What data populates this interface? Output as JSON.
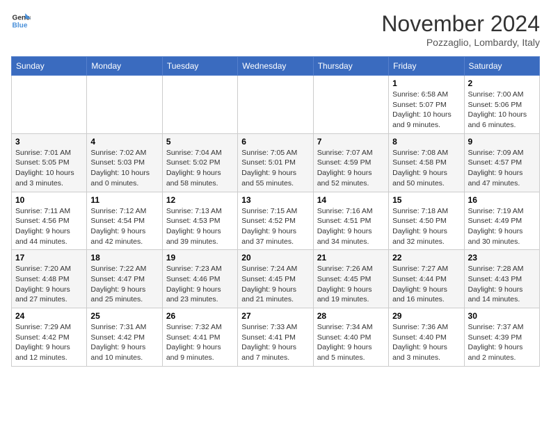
{
  "header": {
    "logo_line1": "General",
    "logo_line2": "Blue",
    "month_title": "November 2024",
    "location": "Pozzaglio, Lombardy, Italy"
  },
  "weekdays": [
    "Sunday",
    "Monday",
    "Tuesday",
    "Wednesday",
    "Thursday",
    "Friday",
    "Saturday"
  ],
  "rows": [
    {
      "cells": [
        {
          "day": "",
          "info": ""
        },
        {
          "day": "",
          "info": ""
        },
        {
          "day": "",
          "info": ""
        },
        {
          "day": "",
          "info": ""
        },
        {
          "day": "",
          "info": ""
        },
        {
          "day": "1",
          "info": "Sunrise: 6:58 AM\nSunset: 5:07 PM\nDaylight: 10 hours\nand 9 minutes."
        },
        {
          "day": "2",
          "info": "Sunrise: 7:00 AM\nSunset: 5:06 PM\nDaylight: 10 hours\nand 6 minutes."
        }
      ]
    },
    {
      "cells": [
        {
          "day": "3",
          "info": "Sunrise: 7:01 AM\nSunset: 5:05 PM\nDaylight: 10 hours\nand 3 minutes."
        },
        {
          "day": "4",
          "info": "Sunrise: 7:02 AM\nSunset: 5:03 PM\nDaylight: 10 hours\nand 0 minutes."
        },
        {
          "day": "5",
          "info": "Sunrise: 7:04 AM\nSunset: 5:02 PM\nDaylight: 9 hours\nand 58 minutes."
        },
        {
          "day": "6",
          "info": "Sunrise: 7:05 AM\nSunset: 5:01 PM\nDaylight: 9 hours\nand 55 minutes."
        },
        {
          "day": "7",
          "info": "Sunrise: 7:07 AM\nSunset: 4:59 PM\nDaylight: 9 hours\nand 52 minutes."
        },
        {
          "day": "8",
          "info": "Sunrise: 7:08 AM\nSunset: 4:58 PM\nDaylight: 9 hours\nand 50 minutes."
        },
        {
          "day": "9",
          "info": "Sunrise: 7:09 AM\nSunset: 4:57 PM\nDaylight: 9 hours\nand 47 minutes."
        }
      ]
    },
    {
      "cells": [
        {
          "day": "10",
          "info": "Sunrise: 7:11 AM\nSunset: 4:56 PM\nDaylight: 9 hours\nand 44 minutes."
        },
        {
          "day": "11",
          "info": "Sunrise: 7:12 AM\nSunset: 4:54 PM\nDaylight: 9 hours\nand 42 minutes."
        },
        {
          "day": "12",
          "info": "Sunrise: 7:13 AM\nSunset: 4:53 PM\nDaylight: 9 hours\nand 39 minutes."
        },
        {
          "day": "13",
          "info": "Sunrise: 7:15 AM\nSunset: 4:52 PM\nDaylight: 9 hours\nand 37 minutes."
        },
        {
          "day": "14",
          "info": "Sunrise: 7:16 AM\nSunset: 4:51 PM\nDaylight: 9 hours\nand 34 minutes."
        },
        {
          "day": "15",
          "info": "Sunrise: 7:18 AM\nSunset: 4:50 PM\nDaylight: 9 hours\nand 32 minutes."
        },
        {
          "day": "16",
          "info": "Sunrise: 7:19 AM\nSunset: 4:49 PM\nDaylight: 9 hours\nand 30 minutes."
        }
      ]
    },
    {
      "cells": [
        {
          "day": "17",
          "info": "Sunrise: 7:20 AM\nSunset: 4:48 PM\nDaylight: 9 hours\nand 27 minutes."
        },
        {
          "day": "18",
          "info": "Sunrise: 7:22 AM\nSunset: 4:47 PM\nDaylight: 9 hours\nand 25 minutes."
        },
        {
          "day": "19",
          "info": "Sunrise: 7:23 AM\nSunset: 4:46 PM\nDaylight: 9 hours\nand 23 minutes."
        },
        {
          "day": "20",
          "info": "Sunrise: 7:24 AM\nSunset: 4:45 PM\nDaylight: 9 hours\nand 21 minutes."
        },
        {
          "day": "21",
          "info": "Sunrise: 7:26 AM\nSunset: 4:45 PM\nDaylight: 9 hours\nand 19 minutes."
        },
        {
          "day": "22",
          "info": "Sunrise: 7:27 AM\nSunset: 4:44 PM\nDaylight: 9 hours\nand 16 minutes."
        },
        {
          "day": "23",
          "info": "Sunrise: 7:28 AM\nSunset: 4:43 PM\nDaylight: 9 hours\nand 14 minutes."
        }
      ]
    },
    {
      "cells": [
        {
          "day": "24",
          "info": "Sunrise: 7:29 AM\nSunset: 4:42 PM\nDaylight: 9 hours\nand 12 minutes."
        },
        {
          "day": "25",
          "info": "Sunrise: 7:31 AM\nSunset: 4:42 PM\nDaylight: 9 hours\nand 10 minutes."
        },
        {
          "day": "26",
          "info": "Sunrise: 7:32 AM\nSunset: 4:41 PM\nDaylight: 9 hours\nand 9 minutes."
        },
        {
          "day": "27",
          "info": "Sunrise: 7:33 AM\nSunset: 4:41 PM\nDaylight: 9 hours\nand 7 minutes."
        },
        {
          "day": "28",
          "info": "Sunrise: 7:34 AM\nSunset: 4:40 PM\nDaylight: 9 hours\nand 5 minutes."
        },
        {
          "day": "29",
          "info": "Sunrise: 7:36 AM\nSunset: 4:40 PM\nDaylight: 9 hours\nand 3 minutes."
        },
        {
          "day": "30",
          "info": "Sunrise: 7:37 AM\nSunset: 4:39 PM\nDaylight: 9 hours\nand 2 minutes."
        }
      ]
    }
  ]
}
